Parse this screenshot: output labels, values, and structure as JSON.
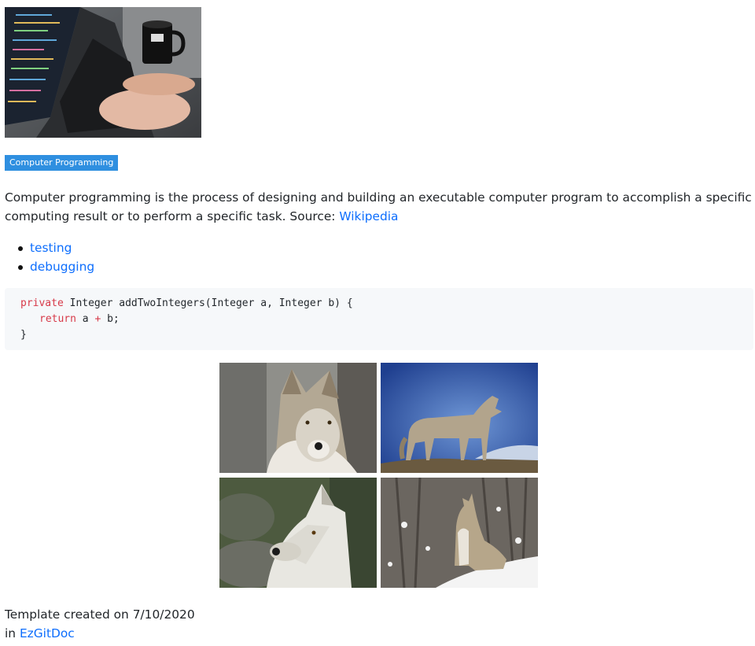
{
  "hero_image": {
    "icon": "laptop-coding-photo"
  },
  "badge": {
    "label": "Computer Programming",
    "color": "#2f8fe0"
  },
  "description": {
    "text": "Computer programming is the process of designing and building an executable computer program to accomplish a specific computing result or to perform a specific task. Source: ",
    "link_label": "Wikipedia"
  },
  "tags": [
    {
      "label": "testing"
    },
    {
      "label": "debugging"
    }
  ],
  "code": {
    "line1": {
      "kw": "private",
      "rest": " Integer addTwoIntegers(Integer a, Integer b) {"
    },
    "line2": {
      "kw": "return",
      "a": " a ",
      "op": "+",
      "b": " b;"
    },
    "line3": "}"
  },
  "gallery": [
    {
      "icon": "wolf-portrait-photo"
    },
    {
      "icon": "wolf-on-hill-photo"
    },
    {
      "icon": "white-wolf-photo"
    },
    {
      "icon": "howling-wolf-photo"
    }
  ],
  "footer": {
    "created_text": "Template created on 7/10/2020",
    "in_text": "in ",
    "link_label": "EzGitDoc"
  },
  "colors": {
    "link": "#0d6efd",
    "keyword": "#d73a49",
    "code_bg": "#f6f8fa"
  }
}
